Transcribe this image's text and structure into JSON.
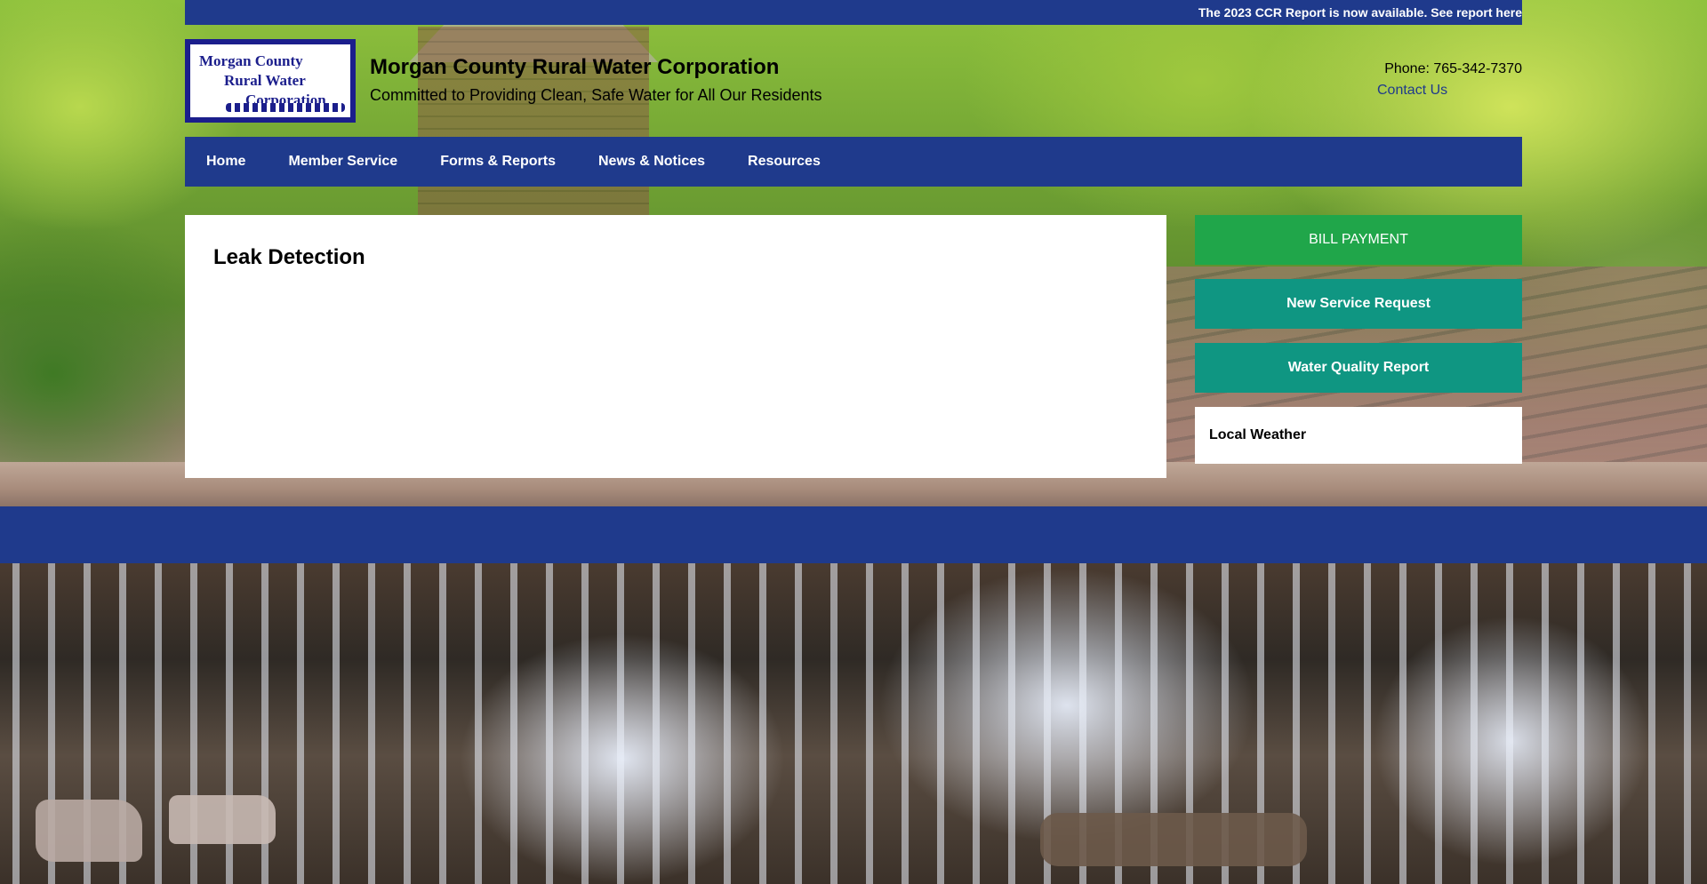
{
  "announcement": {
    "text": "The 2023 CCR Report is now available. See report here"
  },
  "header": {
    "logo": {
      "line1": "Morgan County",
      "line2": "Rural Water",
      "line3": "Corporation"
    },
    "title": "Morgan County Rural Water Corporation",
    "tagline": "Committed to Providing Clean, Safe Water for All Our Residents",
    "phone": "Phone: 765-342-7370",
    "contact_link": "Contact Us"
  },
  "nav": {
    "items": [
      {
        "label": "Home"
      },
      {
        "label": "Member Service"
      },
      {
        "label": "Forms & Reports"
      },
      {
        "label": "News & Notices"
      },
      {
        "label": "Resources"
      }
    ]
  },
  "main": {
    "heading": "Leak Detection"
  },
  "sidebar": {
    "bill_payment": "BILL PAYMENT",
    "new_service": "New Service Request",
    "water_quality": "Water Quality Report",
    "weather_title": "Local Weather"
  },
  "colors": {
    "primary_blue": "#1f3a8c",
    "bill_green": "#20a64a",
    "teal": "#0f9682"
  }
}
